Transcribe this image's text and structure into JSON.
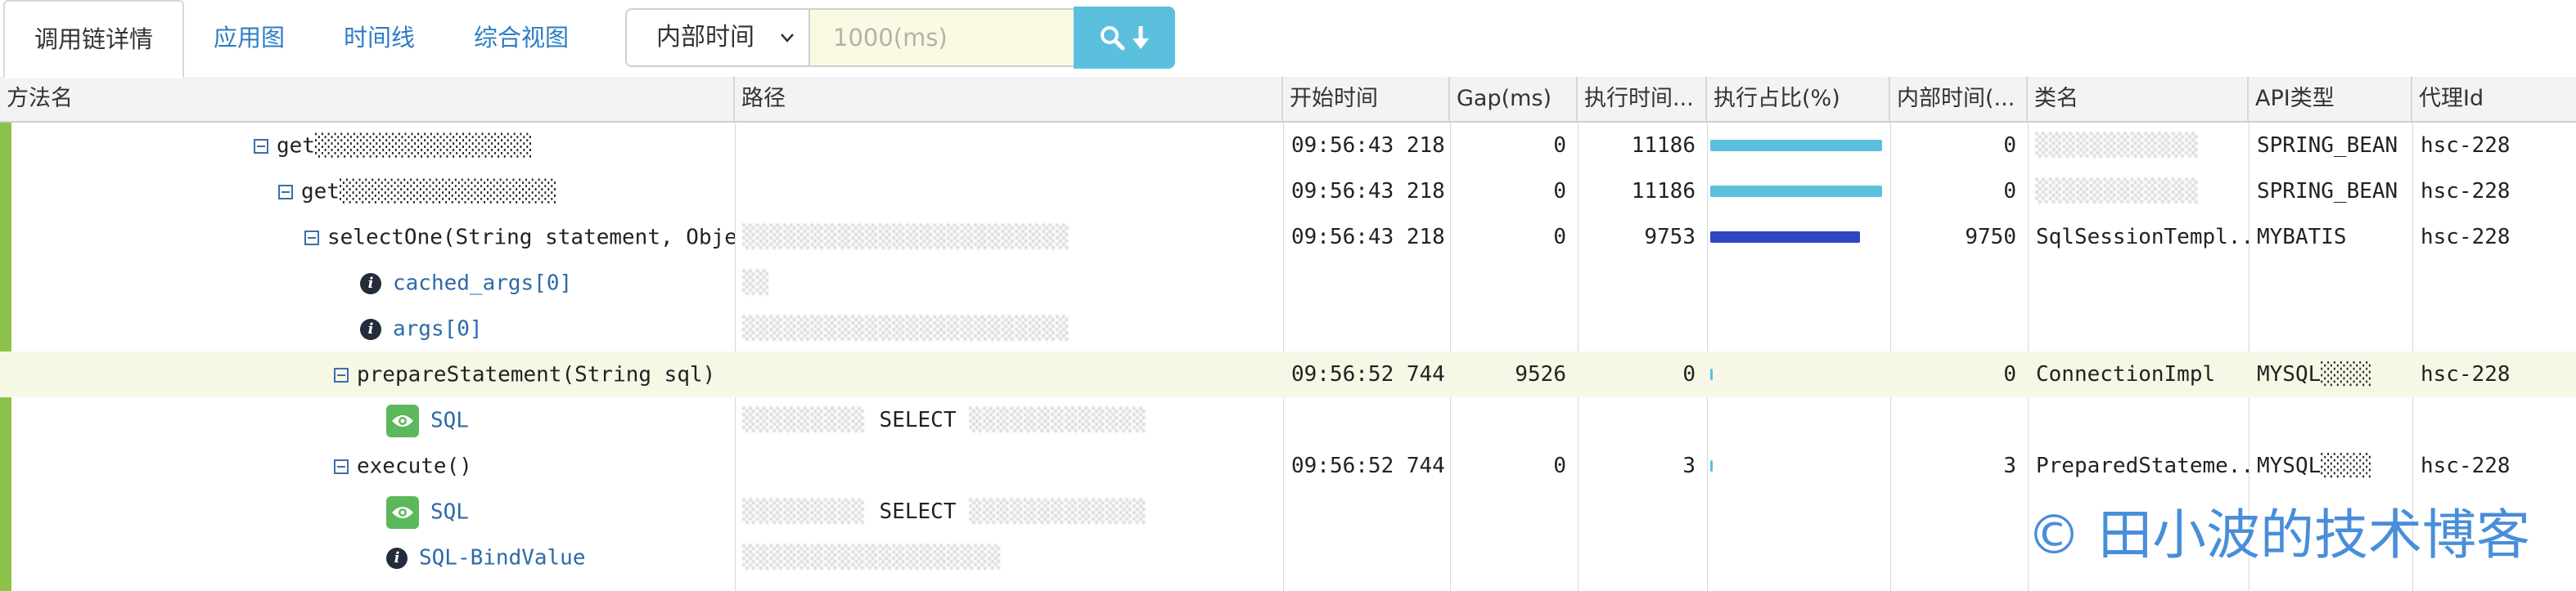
{
  "tabs": [
    "调用链详情",
    "应用图",
    "时间线",
    "综合视图"
  ],
  "filter": {
    "select_value": "内部时间",
    "placeholder": "1000(ms)"
  },
  "columns": [
    "方法名",
    "路径",
    "开始时间",
    "Gap(ms)",
    "执行时间...",
    "执行占比(%)",
    "内部时间(...",
    "类名",
    "API类型",
    "代理Id"
  ],
  "rows": [
    {
      "kind": "method",
      "name": "get░░░░░░░░░░░░░░░░░",
      "path": "",
      "start": "09:56:43 218",
      "gap": "0",
      "exec": "11186",
      "ratio": 1.0,
      "bar_color": "#5bc0de",
      "inner": "0",
      "cls": "░░░░░░░░░░░░",
      "api": "SPRING_BEAN",
      "agent": "hsc-228"
    },
    {
      "kind": "method",
      "name": "get░░░░░░░░░░░░░░░░░",
      "path": "",
      "start": "09:56:43 218",
      "gap": "0",
      "exec": "11186",
      "ratio": 1.0,
      "bar_color": "#5bc0de",
      "inner": "0",
      "cls": "░░░░░░░░░░░░",
      "api": "SPRING_BEAN",
      "agent": "hsc-228"
    },
    {
      "kind": "method",
      "name": "selectOne(String statement, Object",
      "path": "░░░░░░░░░░░░░░░░░░░░░░░░",
      "start": "09:56:43 218",
      "gap": "0",
      "exec": "9753",
      "ratio": 0.87,
      "bar_color": "#2f46c4",
      "inner": "9750",
      "cls": "SqlSessionTempl...",
      "api": "MYBATIS",
      "agent": "hsc-228"
    },
    {
      "kind": "info",
      "name": "cached_args[0]",
      "path": "░░"
    },
    {
      "kind": "info",
      "name": "args[0]",
      "path": "░░░░░░░░░░░░░░░░░░░░░░░░"
    },
    {
      "kind": "method",
      "name": "prepareStatement(String sql)",
      "path": "",
      "start": "09:56:52 744",
      "gap": "9526",
      "exec": "0",
      "ratio": 0.005,
      "bar_color": "#5bc0de",
      "inner": "0",
      "cls": "ConnectionImpl",
      "api": "MYSQL░░░░",
      "agent": "hsc-228",
      "highlight": true
    },
    {
      "kind": "sql",
      "name": "SQL",
      "path": "░░░░░░░░░ SELECT ░░░░░░░░░░░░░"
    },
    {
      "kind": "method",
      "name": "execute()",
      "path": "",
      "start": "09:56:52 744",
      "gap": "0",
      "exec": "3",
      "ratio": 0.005,
      "bar_color": "#5bc0de",
      "inner": "3",
      "cls": "PreparedStateme...",
      "api": "MYSQL░░░░",
      "agent": "hsc-228"
    },
    {
      "kind": "sql",
      "name": "SQL",
      "path": "░░░░░░░░░ SELECT ░░░░░░░░░░░░░"
    },
    {
      "kind": "info",
      "name": "SQL-BindValue",
      "path": "░░░░░░░░░░░░░░░░░░░"
    }
  ],
  "watermark": "© 田小波的技术博客",
  "icons": {
    "search": "search-icon",
    "download": "arrow-down-icon",
    "collapse": "minus-square-icon",
    "info": "info-icon",
    "eye": "eye-icon"
  }
}
